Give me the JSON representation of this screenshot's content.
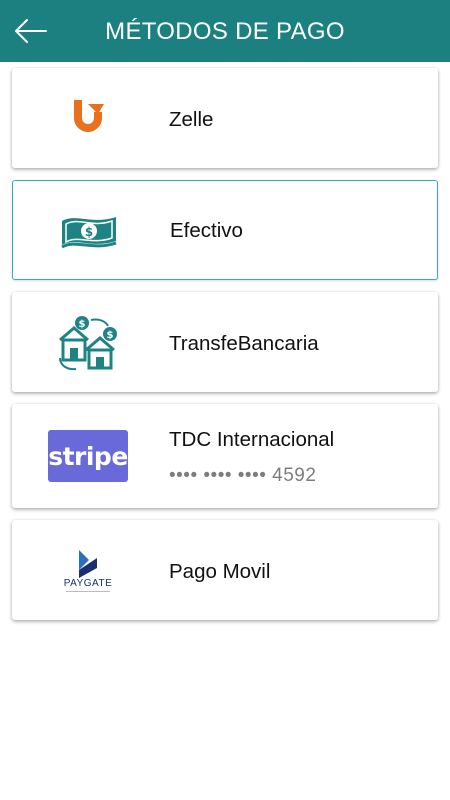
{
  "header": {
    "title": "MÉTODOS DE PAGO",
    "background": "#1c8080"
  },
  "payment_methods": [
    {
      "label": "Zelle",
      "icon": "zelle-icon",
      "selected": false
    },
    {
      "label": "Efectivo",
      "icon": "cash-icon",
      "selected": true
    },
    {
      "label": "TransfeBancaria",
      "icon": "bank-transfer-icon",
      "selected": false
    },
    {
      "label": "TDC Internacional",
      "sublabel": "•••• •••• •••• 4592",
      "icon": "stripe-icon",
      "logo_text": "stripe",
      "selected": false
    },
    {
      "label": "Pago Movil",
      "icon": "paygate-icon",
      "logo_text": "PAYGATE",
      "selected": false
    }
  ],
  "colors": {
    "accent": "#1c8080",
    "selected_border": "#37a9c4",
    "zelle": "#e8701f",
    "stripe": "#6a69d9",
    "icon_teal": "#1e8383"
  }
}
